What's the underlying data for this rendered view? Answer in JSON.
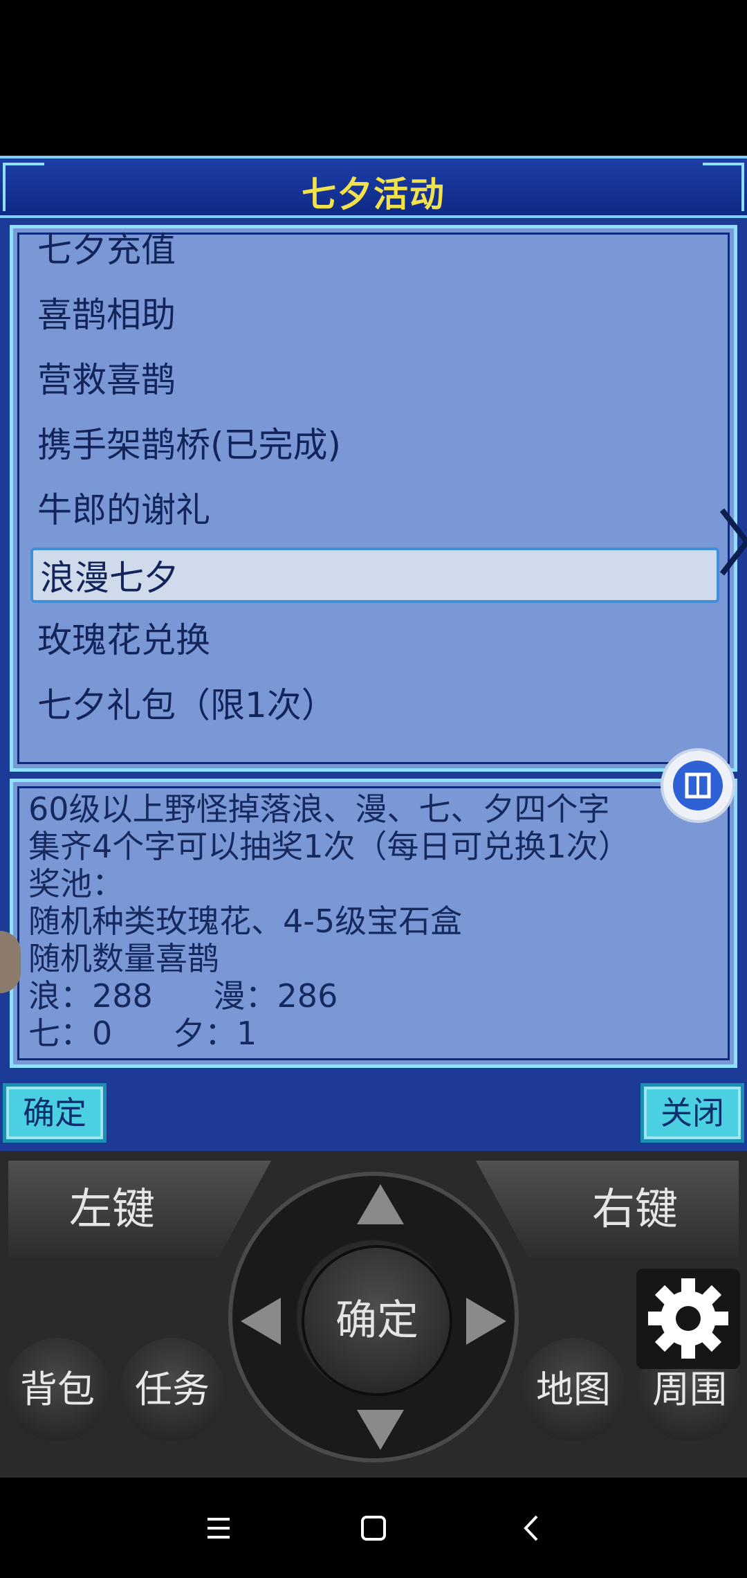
{
  "dialog": {
    "title": "七夕活动",
    "menu_items": [
      {
        "label": "七夕充值"
      },
      {
        "label": "喜鹊相助"
      },
      {
        "label": "营救喜鹊"
      },
      {
        "label": "携手架鹊桥(已完成)"
      },
      {
        "label": "牛郎的谢礼"
      },
      {
        "label": "浪漫七夕",
        "selected": true
      },
      {
        "label": "玫瑰花兑换"
      },
      {
        "label": "七夕礼包（限1次）"
      }
    ],
    "description_lines": [
      "60级以上野怪掉落浪、漫、七、夕四个字",
      "集齐4个字可以抽奖1次（每日可兑换1次）",
      "奖池：",
      "随机种类玫瑰花、4-5级宝石盒",
      "随机数量喜鹊",
      "浪：288      漫：286",
      "七：0      夕：1"
    ],
    "confirm_label": "确定",
    "close_label": "关闭"
  },
  "controller": {
    "left_softkey": "左键",
    "right_softkey": "右键",
    "center_label": "确定",
    "bag_label": "背包",
    "task_label": "任务",
    "map_label": "地图",
    "nearby_label": "周围"
  },
  "colors": {
    "panel_bg": "#7b98d6",
    "title_text": "#f1e14a",
    "border": "#8fe0ff",
    "button_bg": "#4ad0e0"
  }
}
